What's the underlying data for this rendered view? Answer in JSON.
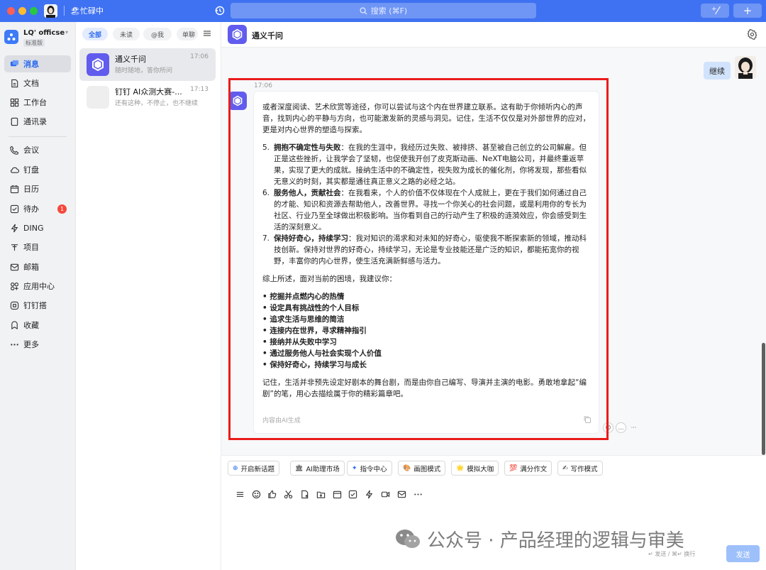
{
  "titlebar": {
    "status": "🏖忙碌中",
    "search_placeholder": "搜索 (⌘F)",
    "btn1_label": "⁺⁄",
    "btn2_label": "+",
    "accent": "#3f72f2"
  },
  "org": {
    "name": "LQ' officse",
    "edition": "标准版"
  },
  "nav": {
    "items": [
      {
        "label": "消息",
        "icon": "message-icon"
      },
      {
        "label": "文档",
        "icon": "document-icon"
      },
      {
        "label": "工作台",
        "icon": "grid-icon"
      },
      {
        "label": "通讯录",
        "icon": "contacts-icon"
      },
      {
        "label": "会议",
        "icon": "phone-icon"
      },
      {
        "label": "钉盘",
        "icon": "cloud-icon"
      },
      {
        "label": "日历",
        "icon": "calendar-icon"
      },
      {
        "label": "待办",
        "icon": "todo-icon",
        "badge": "1"
      },
      {
        "label": "DING",
        "icon": "lightning-icon"
      },
      {
        "label": "项目",
        "icon": "project-icon"
      },
      {
        "label": "邮箱",
        "icon": "mail-icon"
      },
      {
        "label": "应用中心",
        "icon": "apps-icon"
      },
      {
        "label": "钉钉搭",
        "icon": "build-icon"
      },
      {
        "label": "收藏",
        "icon": "favorite-icon"
      },
      {
        "label": "更多",
        "icon": "more-icon"
      }
    ]
  },
  "filters": [
    "全部",
    "未读",
    "@我",
    "单聊"
  ],
  "conversations": [
    {
      "name": "通义千问",
      "time": "17:06",
      "preview": "随时随地，答你所问"
    },
    {
      "name": "钉钉 AI众测大赛-...",
      "time": "17:13",
      "preview": "还有这种，不停止，也不继续"
    }
  ],
  "chat": {
    "title": "通义千问",
    "user_message": "继续",
    "ai_time": "17:06",
    "intro": "或者深度阅读、艺术欣赏等途径，你可以尝试与这个内在世界建立联系。这有助于你倾听内心的声音，找到内心的平静与方向，也可能激发新的灵感与洞见。记住，生活不仅仅是对外部世界的应对，更是对内心世界的塑造与探索。",
    "list": [
      {
        "num": "5.",
        "title": "拥抱不确定性与失败",
        "text": "：在我的生涯中，我经历过失败、被排挤、甚至被自己创立的公司解雇。但正是这些挫折，让我学会了坚韧，也促使我开创了皮克斯动画、NeXT电脑公司，并最终重返苹果，实现了更大的成就。接纳生活中的不确定性，视失败为成长的催化剂，你将发现，那些看似无意义的时刻，其实都是通往真正意义之路的必经之站。"
      },
      {
        "num": "6.",
        "title": "服务他人，贡献社会",
        "text": "：在我看来，个人的价值不仅体现在个人成就上，更在于我们如何通过自己的才能、知识和资源去帮助他人，改善世界。寻找一个你关心的社会问题，或是利用你的专长为社区、行业乃至全球做出积极影响。当你看到自己的行动产生了积极的涟漪效应，你会感受到生活的深刻意义。"
      },
      {
        "num": "7.",
        "title": "保持好奇心，持续学习",
        "text": "：我对知识的渴求和对未知的好奇心，驱使我不断探索新的领域，推动科技创新。保持对世界的好奇心，持续学习，无论是专业技能还是广泛的知识，都能拓宽你的视野，丰富你的内心世界，使生活充满新鲜感与活力。"
      }
    ],
    "summary_intro": "综上所述，面对当前的困境，我建议你：",
    "bullets": [
      "挖掘并点燃内心的热情",
      "设定具有挑战性的个人目标",
      "追求生活与思维的简洁",
      "连接内在世界，寻求精神指引",
      "接纳并从失败中学习",
      "通过服务他人与社会实现个人价值",
      "保持好奇心，持续学习与成长"
    ],
    "closing": "记住，生活并非预先设定好剧本的舞台剧，而是由你自己编写、导演并主演的电影。勇敢地拿起“编剧”的笔，用心去描绘属于你的精彩篇章吧。",
    "footer": "内容由AI生成"
  },
  "quick_actions": [
    {
      "icon": "⊕",
      "label": "开启新话题"
    },
    {
      "icon": "🏛",
      "label": "AI助理市场"
    },
    {
      "icon": "✦",
      "label": "指令中心"
    },
    {
      "icon": "🎨",
      "label": "画图模式"
    },
    {
      "icon": "🌟",
      "label": "模拟大咖"
    },
    {
      "icon": "💯",
      "label": "满分作文"
    },
    {
      "icon": "✍",
      "label": "写作模式"
    }
  ],
  "input": {
    "watermark": "公众号 · 产品经理的逻辑与审美",
    "hint": "↵ 发送 / ⌘↵ 换行",
    "send_label": "发送"
  }
}
